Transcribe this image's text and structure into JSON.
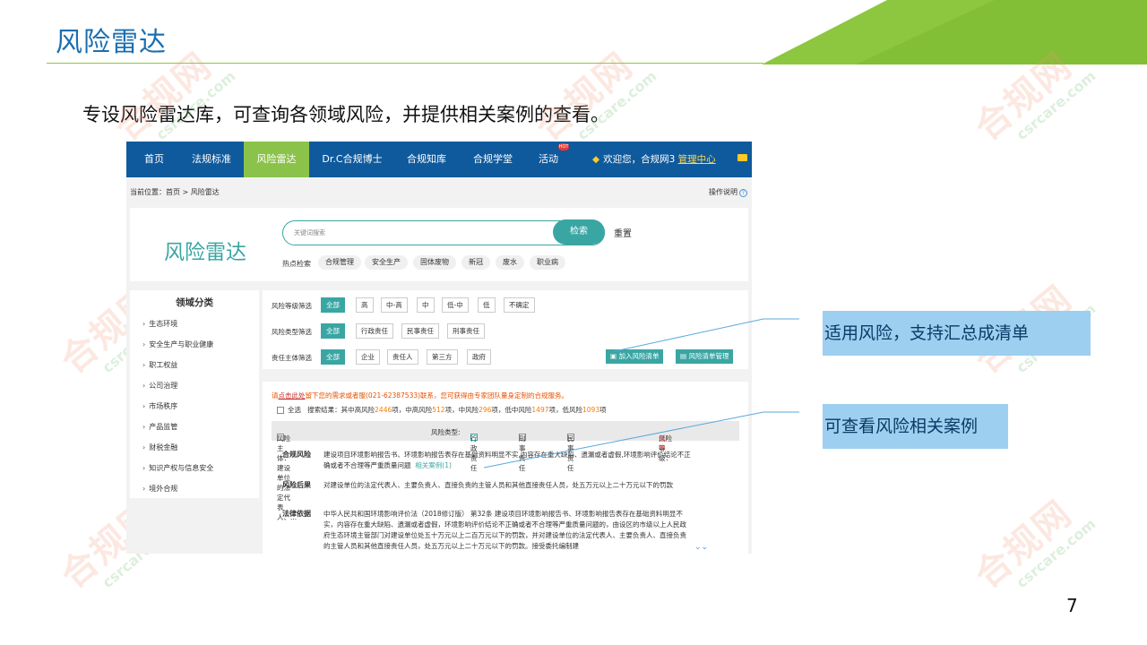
{
  "slide": {
    "title": "风险雷达",
    "subtitle": "专设风险雷达库，可查询各领域风险，并提供相关案例的查看。",
    "page_number": "7",
    "watermark_big": "合规网",
    "watermark_small": "csrcare.com"
  },
  "nav": {
    "items": [
      "首页",
      "法规标准",
      "风险雷达",
      "Dr.C合规博士",
      "合规知库",
      "合规学堂",
      "活动"
    ],
    "active": "风险雷达",
    "hot_badge": "HOT",
    "welcome": "欢迎您，合规网3",
    "manage_link": "管理中心"
  },
  "breadcrumb": "当前位置：首页 > 风险雷达",
  "help": "操作说明",
  "search": {
    "logo": "风险雷达",
    "placeholder": "关键词搜索",
    "button": "检索",
    "reset": "重置",
    "hot_label": "热点检索",
    "hot_tags": [
      "合规管理",
      "安全生产",
      "固体废物",
      "新冠",
      "废水",
      "职业病"
    ]
  },
  "sidebar": {
    "title": "领域分类",
    "items": [
      "生态环境",
      "安全生产与职业健康",
      "职工权益",
      "公司治理",
      "市场秩序",
      "产品监管",
      "财税金融",
      "知识产权与信息安全",
      "境外合规"
    ]
  },
  "filters": {
    "level_label": "风险等级筛选",
    "levels": [
      "全部",
      "高",
      "中-高",
      "中",
      "低-中",
      "低",
      "不确定"
    ],
    "type_label": "风险类型筛选",
    "types": [
      "全部",
      "行政责任",
      "民事责任",
      "刑事责任"
    ],
    "subject_label": "责任主体筛选",
    "subjects": [
      "全部",
      "企业",
      "责任人",
      "第三方",
      "政府"
    ],
    "add_button": "加入风险清单",
    "manage_button": "风险清单管理"
  },
  "results": {
    "notice_prefix": "请",
    "notice_link": "点击此处",
    "notice_rest": "留下您的需求或者服(021-62387533)联系，您可获得由专家团队量身定制的合规服务。",
    "select_all": "全选",
    "summary_prefix": "搜索结果：其中高风险",
    "count_high": "2446",
    "summary_mid_high": "项，中高风险",
    "count_mid_high": "512",
    "summary_mid": "项，中风险",
    "count_mid": "296",
    "summary_low_mid": "项，低中风险",
    "count_low_mid": "1497",
    "summary_low": "项，低风险",
    "count_low": "1093",
    "summary_end": "项",
    "row_subject": "风险主体：建设单位的法定代表人、...",
    "row_type_label": "风险类型:",
    "row_type_admin": "行政责任",
    "row_type_criminal": "刑事责任",
    "row_type_civil": "民事责任",
    "row_level_label": "风险等级：",
    "row_level": "低-中",
    "risk_label": "合规风险",
    "risk_text": "建设项目环境影响报告书、环境影响报告表存在基础资料明显不实,内容存在重大缺陷、遗漏或者虚假,环境影响评价结论不正确或者不合理等严重质量问题",
    "case_link": "相关案例(1)",
    "consequence_label": "风险后果",
    "consequence_text": "对建设单位的法定代表人、主要负责人、直接负责的主管人员和其他直接责任人员，处五万元以上二十万元以下的罚款",
    "basis_label": "法律依据",
    "basis_text": "中华人民共和国环境影响评价法（2018修订版） 第32条  建设项目环境影响报告书、环境影响报告表存在基础资料明显不实，内容存在重大缺陷、遗漏或者虚假，环境影响评价结论不正确或者不合理等严重质量问题的，由设区的市级以上人民政府生态环境主管部门对建设单位处五十万元以上二百万元以下的罚款，并对建设单位的法定代表人、主要负责人、直接负责的主管人员和其他直接责任人员，处五万元以上二十万元以下的罚款。接受委托编制建"
  },
  "callouts": {
    "first": "适用风险，支持汇总成清单",
    "second": "可查看风险相关案例"
  },
  "colors": {
    "title_blue": "#1c6fb0",
    "accent_green": "#8bc34a",
    "nav_blue": "#0f5a9c",
    "teal": "#3aa6a3",
    "callout_bg": "#9dcff0"
  }
}
